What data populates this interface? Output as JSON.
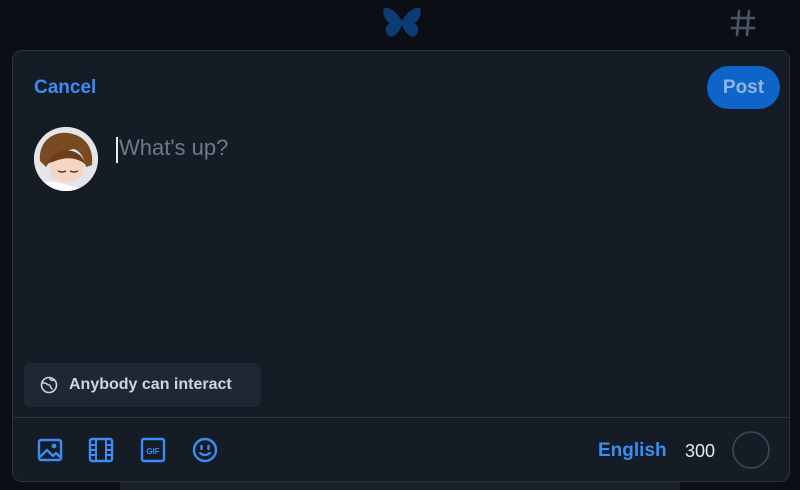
{
  "modal": {
    "cancel_label": "Cancel",
    "post_label": "Post",
    "composer_placeholder": "What's up?",
    "interaction_setting": "Anybody can interact",
    "language": "English",
    "char_remaining": "300"
  },
  "icons": {
    "top_center": "butterfly-logo-icon",
    "top_right": "hashtag-icon",
    "interaction": "globe-icon",
    "toolbar": [
      "image-icon",
      "video-icon",
      "gif-icon",
      "emoji-icon"
    ],
    "counter": "character-progress-ring"
  },
  "colors": {
    "accent": "#3a8df5",
    "post_button": "#0f64c9",
    "modal_bg": "#151c26"
  }
}
